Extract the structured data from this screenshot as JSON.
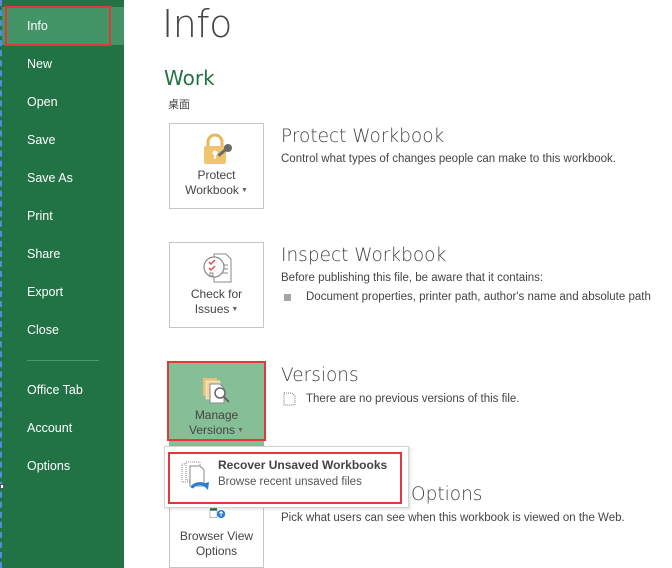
{
  "sidebar": {
    "items": [
      {
        "label": "Info",
        "active": true
      },
      {
        "label": "New"
      },
      {
        "label": "Open"
      },
      {
        "label": "Save"
      },
      {
        "label": "Save As"
      },
      {
        "label": "Print"
      },
      {
        "label": "Share"
      },
      {
        "label": "Export"
      },
      {
        "label": "Close"
      },
      {
        "label": "Office Tab"
      },
      {
        "label": "Account"
      },
      {
        "label": "Options"
      }
    ]
  },
  "main": {
    "title": "Info",
    "workbook_name": "Work",
    "location": "桌面",
    "sections": [
      {
        "button_line1": "Protect",
        "button_line2": "Workbook",
        "icon": "lock-key-icon",
        "title": "Protect Workbook",
        "description": "Control what types of changes people can make to this workbook."
      },
      {
        "button_line1": "Check for",
        "button_line2": "Issues",
        "icon": "checklist-icon",
        "title": "Inspect Workbook",
        "description": "Before publishing this file, be aware that it contains:",
        "bullets": [
          "Document properties, printer path, author's name and absolute path"
        ]
      },
      {
        "button_line1": "Manage",
        "button_line2": "Versions",
        "icon": "versions-search-icon",
        "title": "Versions",
        "description": "There are no previous versions of this file."
      },
      {
        "button_line1": "Browser View",
        "button_line2": "Options",
        "icon": "browser-view-icon",
        "title": "Browser View Options",
        "title_visible": "Options",
        "description": "Pick what users can see when this workbook is viewed on the Web."
      }
    ]
  },
  "dropdown": {
    "items": [
      {
        "title": "Recover Unsaved Workbooks",
        "subtitle": "Browse recent unsaved files",
        "icon": "recover-files-icon"
      }
    ]
  },
  "colors": {
    "sidebar_bg": "#217346",
    "sidebar_active": "#439467",
    "accent_green": "#217346",
    "selected_tile": "#86bf96",
    "highlight_red": "#e8353a"
  }
}
